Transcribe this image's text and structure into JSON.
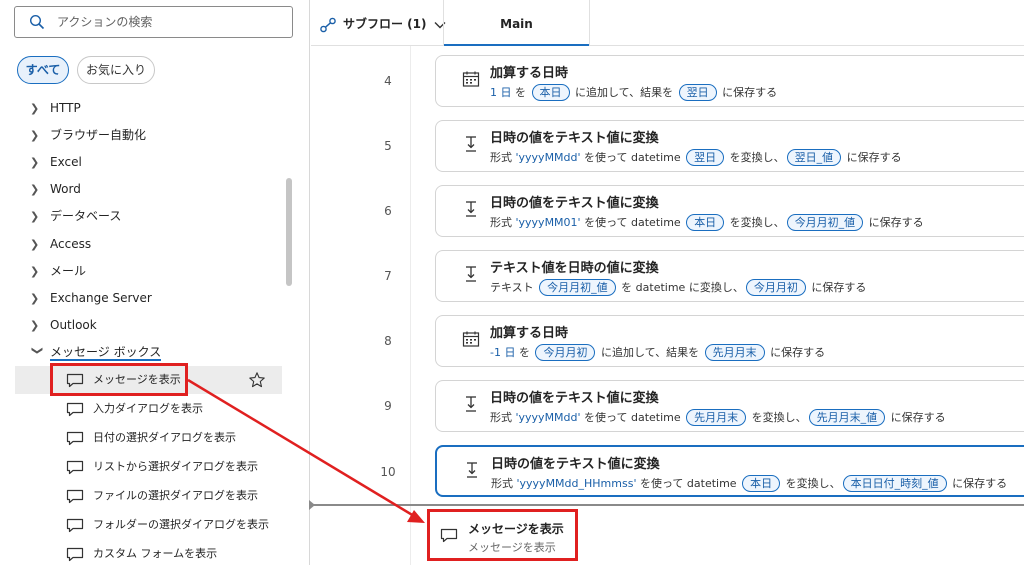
{
  "sidebar": {
    "search_placeholder": "アクションの検索",
    "filters": {
      "all": "すべて",
      "favorites": "お気に入り"
    },
    "groups": [
      {
        "label": "HTTP"
      },
      {
        "label": "ブラウザー自動化"
      },
      {
        "label": "Excel"
      },
      {
        "label": "Word"
      },
      {
        "label": "データベース"
      },
      {
        "label": "Access"
      },
      {
        "label": "メール"
      },
      {
        "label": "Exchange Server"
      },
      {
        "label": "Outlook"
      },
      {
        "label": "メッセージ ボックス"
      }
    ],
    "message_box_actions": [
      {
        "label": "メッセージを表示"
      },
      {
        "label": "入力ダイアログを表示"
      },
      {
        "label": "日付の選択ダイアログを表示"
      },
      {
        "label": "リストから選択ダイアログを表示"
      },
      {
        "label": "ファイルの選択ダイアログを表示"
      },
      {
        "label": "フォルダーの選択ダイアログを表示"
      },
      {
        "label": "カスタム フォームを表示"
      }
    ]
  },
  "tabs": {
    "subflow_label": "サブフロー (1)",
    "main_label": "Main"
  },
  "steps": [
    {
      "number": "4",
      "icon": "calendar-icon",
      "title": "加算する日時",
      "desc": [
        {
          "t": "lit",
          "v": "1 日"
        },
        {
          "t": "txt",
          "v": " を "
        },
        {
          "t": "var",
          "v": "本日"
        },
        {
          "t": "txt",
          "v": " に追加して、結果を "
        },
        {
          "t": "var",
          "v": "翌日"
        },
        {
          "t": "txt",
          "v": " に保存する"
        }
      ]
    },
    {
      "number": "5",
      "icon": "convert-icon",
      "title": "日時の値をテキスト値に変換",
      "desc": [
        {
          "t": "txt",
          "v": "形式 "
        },
        {
          "t": "lit",
          "v": "'yyyyMMdd'"
        },
        {
          "t": "txt",
          "v": " を使って datetime "
        },
        {
          "t": "var",
          "v": "翌日"
        },
        {
          "t": "txt",
          "v": " を変換し、"
        },
        {
          "t": "var",
          "v": "翌日_値"
        },
        {
          "t": "txt",
          "v": " に保存する"
        }
      ]
    },
    {
      "number": "6",
      "icon": "convert-icon",
      "title": "日時の値をテキスト値に変換",
      "desc": [
        {
          "t": "txt",
          "v": "形式 "
        },
        {
          "t": "lit",
          "v": "'yyyyMM01'"
        },
        {
          "t": "txt",
          "v": " を使って datetime "
        },
        {
          "t": "var",
          "v": "本日"
        },
        {
          "t": "txt",
          "v": " を変換し、"
        },
        {
          "t": "var",
          "v": "今月月初_値"
        },
        {
          "t": "txt",
          "v": " に保存する"
        }
      ]
    },
    {
      "number": "7",
      "icon": "convert-icon",
      "title": "テキスト値を日時の値に変換",
      "desc": [
        {
          "t": "txt",
          "v": "テキスト "
        },
        {
          "t": "var",
          "v": "今月月初_値"
        },
        {
          "t": "txt",
          "v": " を datetime に変換し、"
        },
        {
          "t": "var",
          "v": "今月月初"
        },
        {
          "t": "txt",
          "v": " に保存する"
        }
      ]
    },
    {
      "number": "8",
      "icon": "calendar-icon",
      "title": "加算する日時",
      "desc": [
        {
          "t": "lit",
          "v": "-1 日"
        },
        {
          "t": "txt",
          "v": " を "
        },
        {
          "t": "var",
          "v": "今月月初"
        },
        {
          "t": "txt",
          "v": " に追加して、結果を "
        },
        {
          "t": "var",
          "v": "先月月末"
        },
        {
          "t": "txt",
          "v": " に保存する"
        }
      ]
    },
    {
      "number": "9",
      "icon": "convert-icon",
      "title": "日時の値をテキスト値に変換",
      "desc": [
        {
          "t": "txt",
          "v": "形式 "
        },
        {
          "t": "lit",
          "v": "'yyyyMMdd'"
        },
        {
          "t": "txt",
          "v": " を使って datetime "
        },
        {
          "t": "var",
          "v": "先月月末"
        },
        {
          "t": "txt",
          "v": " を変換し、"
        },
        {
          "t": "var",
          "v": "先月月末_値"
        },
        {
          "t": "txt",
          "v": " に保存する"
        }
      ]
    },
    {
      "number": "10",
      "icon": "convert-icon",
      "title": "日時の値をテキスト値に変換",
      "desc": [
        {
          "t": "txt",
          "v": "形式 "
        },
        {
          "t": "lit",
          "v": "'yyyyMMdd_HHmmss'"
        },
        {
          "t": "txt",
          "v": " を使って datetime "
        },
        {
          "t": "var",
          "v": "本日"
        },
        {
          "t": "txt",
          "v": " を変換し、"
        },
        {
          "t": "var",
          "v": "本日日付_時刻_値"
        },
        {
          "t": "txt",
          "v": " に保存する"
        }
      ]
    }
  ],
  "drag_preview": {
    "title": "メッセージを表示",
    "subtitle": "メッセージを表示"
  },
  "colors": {
    "accent": "#1a6ec0",
    "highlight": "#e02020"
  }
}
